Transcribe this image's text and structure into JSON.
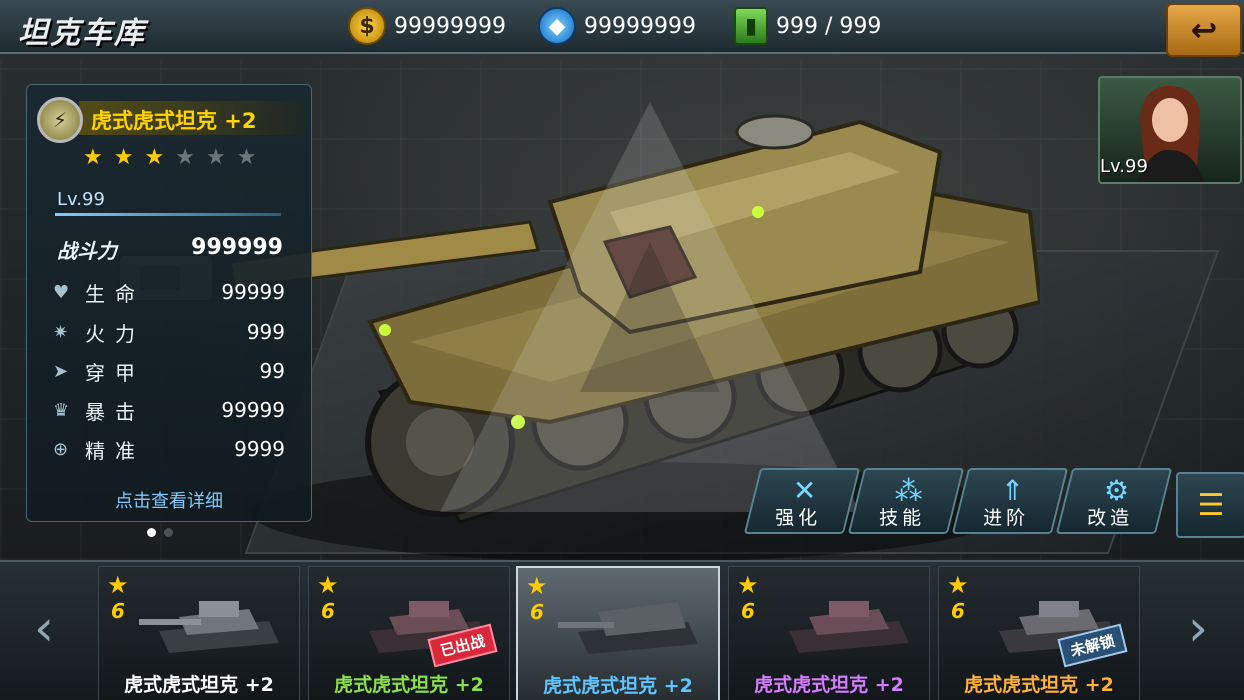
{
  "header": {
    "title": "坦克车库",
    "gold": "99999999",
    "gems": "99999999",
    "fuel": "999 / 999",
    "back_icon": "back-arrow-icon"
  },
  "tank": {
    "name": "虎式虎式坦克 +2",
    "stars_filled": 3,
    "stars_total": 6,
    "level": "Lv.99",
    "power_label": "战斗力",
    "power_value": "999999",
    "stats": [
      {
        "icon": "heart-icon",
        "label": "生命",
        "value": "99999"
      },
      {
        "icon": "firepower-icon",
        "label": "火力",
        "value": "999"
      },
      {
        "icon": "armor-icon",
        "label": "穿甲",
        "value": "99"
      },
      {
        "icon": "crit-icon",
        "label": "暴击",
        "value": "99999"
      },
      {
        "icon": "precision-icon",
        "label": "精准",
        "value": "9999"
      }
    ],
    "detail_link": "点击查看详细"
  },
  "commander": {
    "level": "Lv.99"
  },
  "actions": [
    {
      "label": "强化",
      "icon": "wrench-icon"
    },
    {
      "label": "技能",
      "icon": "skill-icon"
    },
    {
      "label": "进阶",
      "icon": "upgrade-arrow-icon"
    },
    {
      "label": "改造",
      "icon": "modify-icon"
    }
  ],
  "carousel": [
    {
      "rank": "6",
      "name": "虎式虎式坦克 +2",
      "color": "#ffffff",
      "tag": ""
    },
    {
      "rank": "6",
      "name": "虎式虎式坦克 +2",
      "color": "#8ee04b",
      "tag": "已出战"
    },
    {
      "rank": "6",
      "name": "虎式虎式坦克 +2",
      "color": "#5fc4ff",
      "tag": ""
    },
    {
      "rank": "6",
      "name": "虎式虎式坦克 +2",
      "color": "#d57cff",
      "tag": ""
    },
    {
      "rank": "6",
      "name": "虎式虎式坦克 +2",
      "color": "#ffb13a",
      "tag": "未解锁"
    }
  ]
}
